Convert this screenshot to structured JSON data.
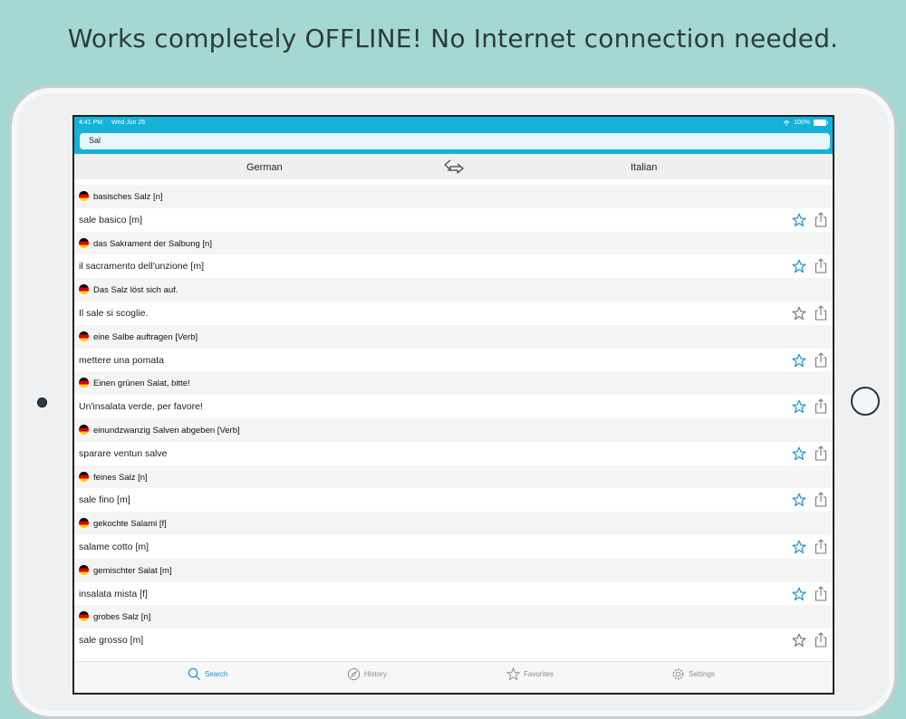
{
  "headline": "Works completely OFFLINE! No Internet connection needed.",
  "status_bar": {
    "time": "4:41 PM",
    "date": "Wed Jun 26",
    "battery": "100%"
  },
  "search": {
    "value": "Sal"
  },
  "languages": {
    "from": "German",
    "to": "Italian"
  },
  "colors": {
    "accent": "#14b2d8",
    "star_active": "#1e8fd6",
    "star_inactive": "#777777",
    "background": "#a6d8d3"
  },
  "results": [
    {
      "source": "basisches Salz [n]",
      "target": "sale basico [m]",
      "favorite_color": "blue"
    },
    {
      "source": "das Sakrament der Salbung [n]",
      "target": "il sacramento dell'unzione [m]",
      "favorite_color": "blue"
    },
    {
      "source": "Das Salz löst sich auf.",
      "target": "Il sale si scoglie.",
      "favorite_color": "gray"
    },
    {
      "source": "eine Salbe auftragen [Verb]",
      "target": "mettere una pomata",
      "favorite_color": "blue"
    },
    {
      "source": "Einen grünen Salat, bitte!",
      "target": "Un'insalata verde, per favore!",
      "favorite_color": "blue"
    },
    {
      "source": "einundzwanzig Salven abgeben [Verb]",
      "target": "sparare ventun salve",
      "favorite_color": "blue"
    },
    {
      "source": "feines Salz [n]",
      "target": "sale fino [m]",
      "favorite_color": "blue"
    },
    {
      "source": "gekochte Salami [f]",
      "target": "salame cotto [m]",
      "favorite_color": "blue"
    },
    {
      "source": "gemischter Salat [m]",
      "target": "insalata mista [f]",
      "favorite_color": "blue"
    },
    {
      "source": "grobes Salz [n]",
      "target": "sale grosso [m]",
      "favorite_color": "gray"
    }
  ],
  "tabs": [
    {
      "label": "Search",
      "icon": "search-icon",
      "active": true
    },
    {
      "label": "History",
      "icon": "compass-icon",
      "active": false
    },
    {
      "label": "Favorites",
      "icon": "star-icon",
      "active": false
    },
    {
      "label": "Settings",
      "icon": "gear-icon",
      "active": false
    }
  ]
}
